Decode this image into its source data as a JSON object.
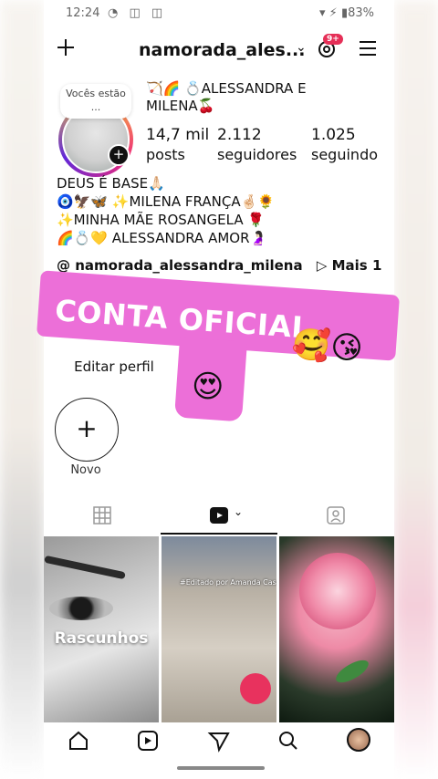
{
  "status_bar": {
    "time": "12:24",
    "battery": "83%"
  },
  "header": {
    "username": "namorada_ales...",
    "notification_count": "9+"
  },
  "profile": {
    "note_text": "Vocês estão ...",
    "display_name": "🏹🌈 💍ALESSANDRA E MILENA🍒",
    "stats": [
      {
        "number": "14,7 mil",
        "label": "posts"
      },
      {
        "number": "2.112",
        "label": "seguidores"
      },
      {
        "number": "1.025",
        "label": "seguindo"
      }
    ],
    "bio_lines": [
      "DEUS É BASE🙏🏻",
      "🧿🦅🦋 ✨MILENA FRANÇA🤞🏻🌻",
      "✨MINHA MÃE ROSANGELA 🌹",
      "🌈💍💛 ALESSANDRA AMOR🤰🏻"
    ],
    "threads_link": "namorada_alessandra_milena",
    "more_label": "Mais 1",
    "edit_profile_label": "Editar perfil"
  },
  "sticker": {
    "text": "CONTA OFICIAL",
    "emojis_line1": "🥰😘",
    "emoji_line2": "😍"
  },
  "highlights": [
    {
      "label": "Novo"
    }
  ],
  "grid": {
    "drafts_label": "Rascunhos",
    "video_caption": "#Editado por Amanda Cassia"
  },
  "colors": {
    "sticker_pink": "#ec6fd8",
    "badge_red": "#e52f57"
  }
}
